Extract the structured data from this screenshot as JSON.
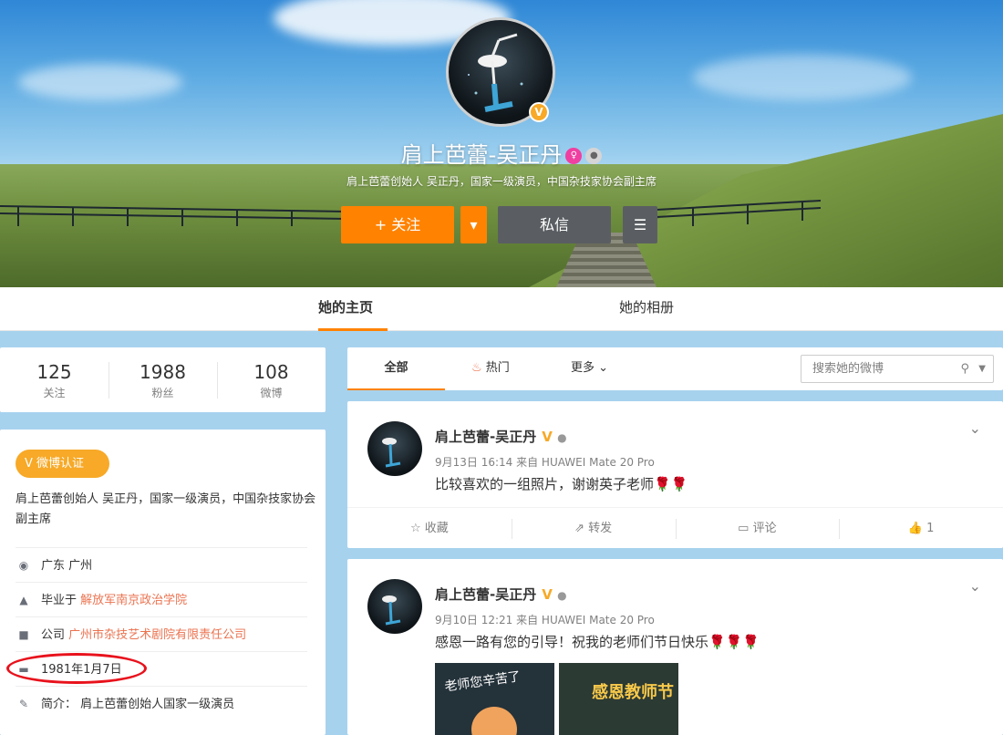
{
  "profile": {
    "name": "肩上芭蕾-吴正丹",
    "verified_mark": "V",
    "description": "肩上芭蕾创始人 吴正丹，国家一级演员，中国杂技家协会副主席"
  },
  "actions": {
    "follow": "+ 关注",
    "message": "私信"
  },
  "tabs": {
    "home": "她的主页",
    "album": "她的相册"
  },
  "stats": [
    {
      "value": "125",
      "label": "关注"
    },
    {
      "value": "1988",
      "label": "粉丝"
    },
    {
      "value": "108",
      "label": "微博"
    }
  ],
  "info": {
    "cert_badge": "V 微博认证",
    "intro": "肩上芭蕾创始人 吴正丹，国家一级演员，中国杂技家协会副主席",
    "location": "广东 广州",
    "school_prefix": "毕业于",
    "school": "解放军南京政治学院",
    "company_prefix": "公司",
    "company": "广州市杂技艺术剧院有限责任公司",
    "birthday": "1981年1月7日",
    "bio": "简介： 肩上芭蕾创始人国家一级演员"
  },
  "feed_filter": {
    "all": "全部",
    "hot": "热门",
    "more": "更多",
    "search_placeholder": "搜索她的微博"
  },
  "posts": [
    {
      "user": "肩上芭蕾-吴正丹",
      "meta": "9月13日 16:14 来自 HUAWEI Mate 20 Pro",
      "text": "比较喜欢的一组照片，谢谢英子老师",
      "roses": "🌹🌹",
      "actions": {
        "fav": "收藏",
        "repost": "转发",
        "comment": "评论",
        "like": "1"
      }
    },
    {
      "user": "肩上芭蕾-吴正丹",
      "meta": "9月10日 12:21 来自 HUAWEI Mate 20 Pro",
      "text": "感恩一路有您的引导！祝我的老师们节日快乐",
      "roses": "🌹🌹🌹",
      "images": [
        "老师您辛苦了",
        "感恩教师节"
      ]
    }
  ],
  "colors": {
    "accent": "#ff8200",
    "verified": "#f7a927",
    "link": "#eb7350",
    "annotation": "#e8121c"
  }
}
